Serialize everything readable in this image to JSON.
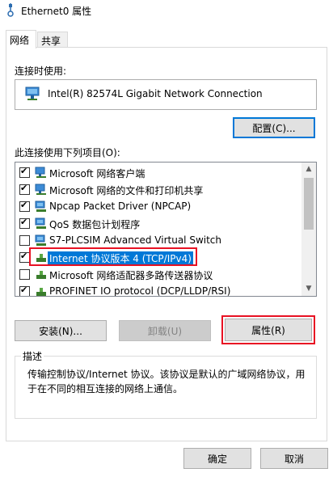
{
  "window": {
    "title": "Ethernet0 属性"
  },
  "tabs": [
    {
      "label": "网络"
    },
    {
      "label": "共享"
    }
  ],
  "connect_using": {
    "label": "连接时使用:",
    "adapter": "Intel(R) 82574L Gigabit Network Connection",
    "configure_label": "配置(C)..."
  },
  "items_section": {
    "label": "此连接使用下列项目(O):",
    "items": [
      {
        "label": "Microsoft 网络客户端",
        "checked": true,
        "icon": "network-client-icon"
      },
      {
        "label": "Microsoft 网络的文件和打印机共享",
        "checked": true,
        "icon": "file-printer-sharing-icon"
      },
      {
        "label": "Npcap Packet Driver (NPCAP)",
        "checked": true,
        "icon": "service-icon"
      },
      {
        "label": "QoS 数据包计划程序",
        "checked": true,
        "icon": "service-icon"
      },
      {
        "label": "S7-PLCSIM Advanced Virtual Switch",
        "checked": false,
        "icon": "service-icon"
      },
      {
        "label": "Internet 协议版本 4 (TCP/IPv4)",
        "checked": true,
        "icon": "protocol-icon",
        "selected": true
      },
      {
        "label": "Microsoft 网络适配器多路传送器协议",
        "checked": false,
        "icon": "protocol-icon"
      },
      {
        "label": "PROFINET IO protocol (DCP/LLDP/RSI)",
        "checked": true,
        "icon": "protocol-icon"
      }
    ]
  },
  "buttons": {
    "install": "安装(N)...",
    "uninstall": "卸载(U)",
    "properties": "属性(R)"
  },
  "description": {
    "title": "描述",
    "text": "传输控制协议/Internet 协议。该协议是默认的广域网络协议，用于在不同的相互连接的网络上通信。"
  },
  "footer": {
    "ok": "确定",
    "cancel": "取消"
  },
  "colors": {
    "selection": "#0078d7",
    "highlight_outline": "#e81123",
    "window_bg": "#f0f0f0"
  }
}
